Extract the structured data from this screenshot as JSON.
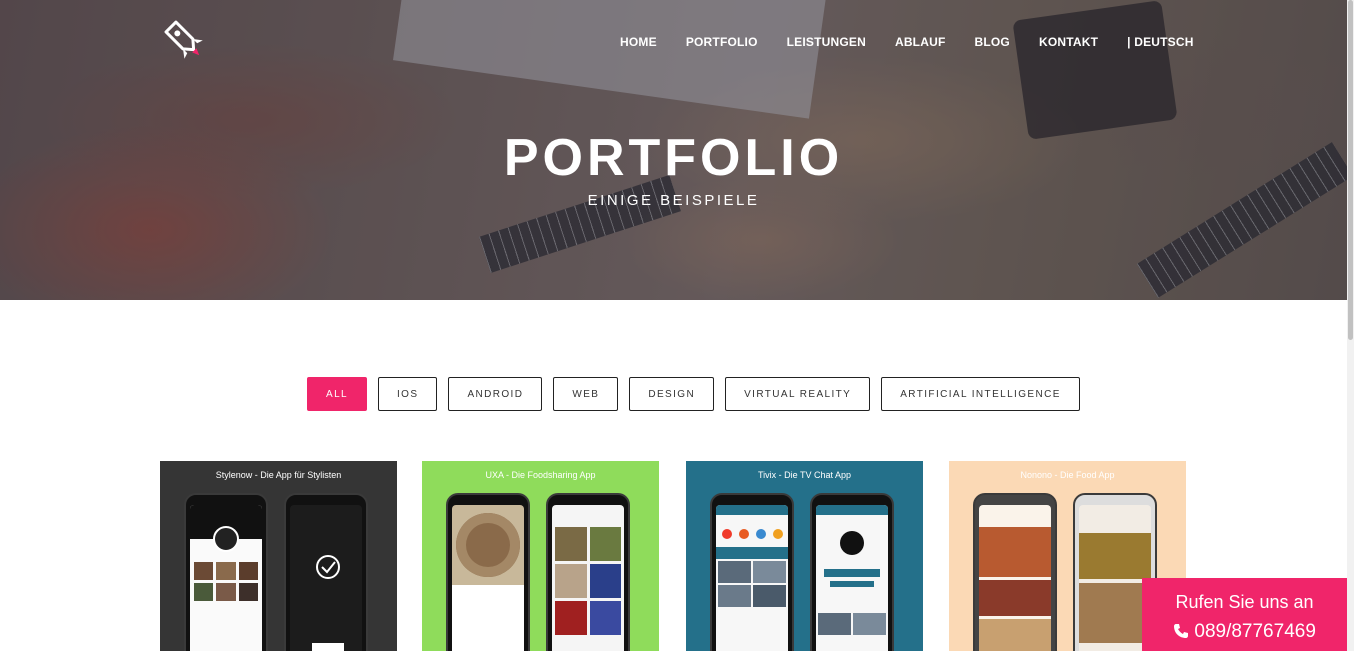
{
  "colors": {
    "accent": "#f0256a",
    "white": "#ffffff",
    "text_dark": "#333333"
  },
  "logo": {
    "icon": "rocket-icon"
  },
  "nav": {
    "items": [
      {
        "label": "HOME"
      },
      {
        "label": "PORTFOLIO"
      },
      {
        "label": "LEISTUNGEN"
      },
      {
        "label": "ABLAUF"
      },
      {
        "label": "BLOG"
      },
      {
        "label": "KONTAKT"
      },
      {
        "label": "| DEUTSCH"
      }
    ]
  },
  "hero": {
    "title": "PORTFOLIO",
    "subtitle": "EINIGE BEISPIELE"
  },
  "filters": {
    "items": [
      {
        "label": "ALL"
      },
      {
        "label": "IOS"
      },
      {
        "label": "ANDROID"
      },
      {
        "label": "WEB"
      },
      {
        "label": "DESIGN"
      },
      {
        "label": "VIRTUAL REALITY"
      },
      {
        "label": "ARTIFICIAL INTELLIGENCE"
      }
    ],
    "active": "ALL"
  },
  "portfolio": {
    "items": [
      {
        "caption": "Stylenow - Die App für Stylisten",
        "bg": "#353535"
      },
      {
        "caption": "UXA - Die Foodsharing App",
        "bg": "#8fdc5b"
      },
      {
        "caption": "Tivix - Die TV Chat App",
        "bg": "#24708a"
      },
      {
        "caption": "Nonono - Die Food App",
        "bg": "#fbd9b5"
      }
    ]
  },
  "callbox": {
    "line1": "Rufen Sie uns an",
    "phone": "089/87767469",
    "icon": "phone-icon"
  }
}
